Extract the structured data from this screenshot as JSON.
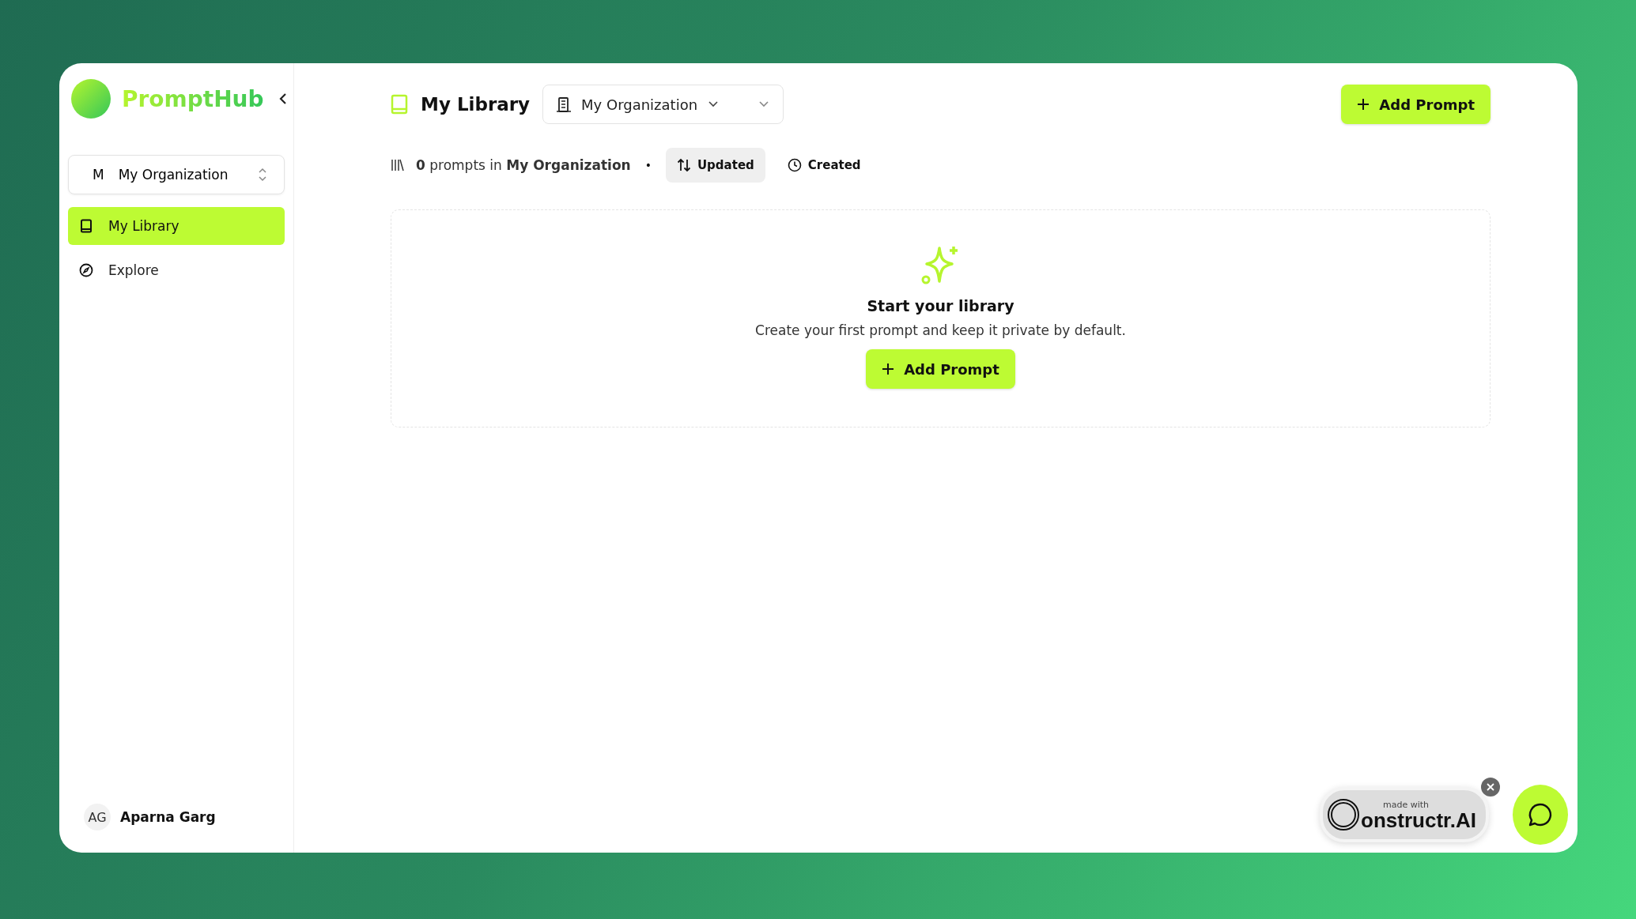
{
  "sidebar": {
    "brand": "PromptHub",
    "org_switcher": {
      "initial": "M",
      "name": "My Organization"
    },
    "items": [
      {
        "label": "My Library",
        "selected": true
      },
      {
        "label": "Explore",
        "selected": false
      }
    ],
    "user": {
      "initials": "AG",
      "name": "Aparna Garg"
    }
  },
  "header": {
    "title": "My Library",
    "org_select": "My Organization",
    "add_button": "Add Prompt"
  },
  "stats": {
    "text": "**0** prompts in **My Organization**",
    "separator": "•",
    "sort_options": [
      {
        "label": "Updated",
        "selected": true
      },
      {
        "label": "Created",
        "selected": false
      }
    ]
  },
  "empty_state": {
    "title": "Start your library",
    "description": "Create your first prompt and keep it private by default.",
    "button": "Add Prompt"
  },
  "badge": {
    "small": "made with",
    "logo": "onstructr.AI"
  }
}
